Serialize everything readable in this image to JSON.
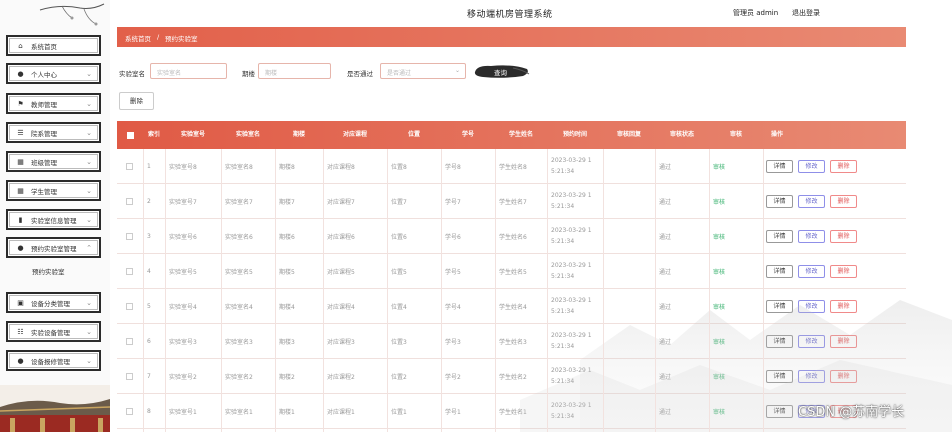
{
  "header": {
    "title": "移动端机房管理系统",
    "admin": "管理员 admin",
    "logout": "退出登录"
  },
  "breadcrumb": {
    "home": "系统首页",
    "sep": "/",
    "current": "预约实验室"
  },
  "sidebar": {
    "items": [
      {
        "label": "系统首页",
        "icon": "home-icon",
        "glyph": "⌂",
        "chev": ""
      },
      {
        "label": "个人中心",
        "icon": "user-icon",
        "glyph": "●",
        "chev": "⌄"
      },
      {
        "label": "教师管理",
        "icon": "flag-icon",
        "glyph": "⚑",
        "chev": "⌄"
      },
      {
        "label": "院系管理",
        "icon": "list-icon",
        "glyph": "☰",
        "chev": "⌄"
      },
      {
        "label": "班级管理",
        "icon": "grid-icon",
        "glyph": "▦",
        "chev": "⌄"
      },
      {
        "label": "学生管理",
        "icon": "grid-icon",
        "glyph": "▦",
        "chev": "⌄"
      },
      {
        "label": "实验室信息管理",
        "icon": "bar-chart-icon",
        "glyph": "▮",
        "chev": "⌄"
      },
      {
        "label": "预约实验室管理",
        "icon": "user-icon",
        "glyph": "●",
        "chev": "⌃"
      },
      {
        "label": "设备分类管理",
        "icon": "clipboard-icon",
        "glyph": "▣",
        "chev": "⌄"
      },
      {
        "label": "实验设备管理",
        "icon": "sliders-icon",
        "glyph": "☷",
        "chev": "⌄"
      },
      {
        "label": "设备报修管理",
        "icon": "user-icon",
        "glyph": "●",
        "chev": "⌄"
      }
    ],
    "sub_item": "预约实验室"
  },
  "search": {
    "name_label": "实验室名",
    "name_placeholder": "实验室名",
    "floor_label": "期楼",
    "floor_placeholder": "期楼",
    "passed_label": "是否通过",
    "passed_placeholder": "是否通过",
    "query_label": "查询"
  },
  "delete_label": "删除",
  "table": {
    "headers": [
      "索引",
      "实验室号",
      "实验室名",
      "期楼",
      "对应课程",
      "位置",
      "学号",
      "学生姓名",
      "预约时间",
      "审核回复",
      "审核状态",
      "审核",
      "操作"
    ],
    "rows": [
      {
        "idx": "1",
        "no": "实验室号8",
        "name": "实验室名8",
        "floor": "期楼8",
        "course": "对应课程8",
        "pos": "位置8",
        "sid": "学号8",
        "sname": "学生姓名8",
        "t1": "2023-03-29 1",
        "t2": "5:21:34",
        "reply": "",
        "status": "通过",
        "audit": "审核"
      },
      {
        "idx": "2",
        "no": "实验室号7",
        "name": "实验室名7",
        "floor": "期楼7",
        "course": "对应课程7",
        "pos": "位置7",
        "sid": "学号7",
        "sname": "学生姓名7",
        "t1": "2023-03-29 1",
        "t2": "5:21:34",
        "reply": "",
        "status": "通过",
        "audit": "审核"
      },
      {
        "idx": "3",
        "no": "实验室号6",
        "name": "实验室名6",
        "floor": "期楼6",
        "course": "对应课程6",
        "pos": "位置6",
        "sid": "学号6",
        "sname": "学生姓名6",
        "t1": "2023-03-29 1",
        "t2": "5:21:34",
        "reply": "",
        "status": "通过",
        "audit": "审核"
      },
      {
        "idx": "4",
        "no": "实验室号5",
        "name": "实验室名5",
        "floor": "期楼5",
        "course": "对应课程5",
        "pos": "位置5",
        "sid": "学号5",
        "sname": "学生姓名5",
        "t1": "2023-03-29 1",
        "t2": "5:21:34",
        "reply": "",
        "status": "通过",
        "audit": "审核"
      },
      {
        "idx": "5",
        "no": "实验室号4",
        "name": "实验室名4",
        "floor": "期楼4",
        "course": "对应课程4",
        "pos": "位置4",
        "sid": "学号4",
        "sname": "学生姓名4",
        "t1": "2023-03-29 1",
        "t2": "5:21:34",
        "reply": "",
        "status": "通过",
        "audit": "审核"
      },
      {
        "idx": "6",
        "no": "实验室号3",
        "name": "实验室名3",
        "floor": "期楼3",
        "course": "对应课程3",
        "pos": "位置3",
        "sid": "学号3",
        "sname": "学生姓名3",
        "t1": "2023-03-29 1",
        "t2": "5:21:34",
        "reply": "",
        "status": "通过",
        "audit": "审核"
      },
      {
        "idx": "7",
        "no": "实验室号2",
        "name": "实验室名2",
        "floor": "期楼2",
        "course": "对应课程2",
        "pos": "位置2",
        "sid": "学号2",
        "sname": "学生姓名2",
        "t1": "2023-03-29 1",
        "t2": "5:21:34",
        "reply": "",
        "status": "通过",
        "audit": "审核"
      },
      {
        "idx": "8",
        "no": "实验室号1",
        "name": "实验室名1",
        "floor": "期楼1",
        "course": "对应课程1",
        "pos": "位置1",
        "sid": "学号1",
        "sname": "学生姓名1",
        "t1": "2023-03-29 1",
        "t2": "5:21:34",
        "reply": "",
        "status": "通过",
        "audit": "审核"
      }
    ],
    "actions": {
      "detail": "详情",
      "edit": "修改",
      "delete": "删除"
    }
  },
  "watermark": "CSDN @苏南学长",
  "colors": {
    "accent": "#e2604a",
    "approve": "#3cb371"
  }
}
